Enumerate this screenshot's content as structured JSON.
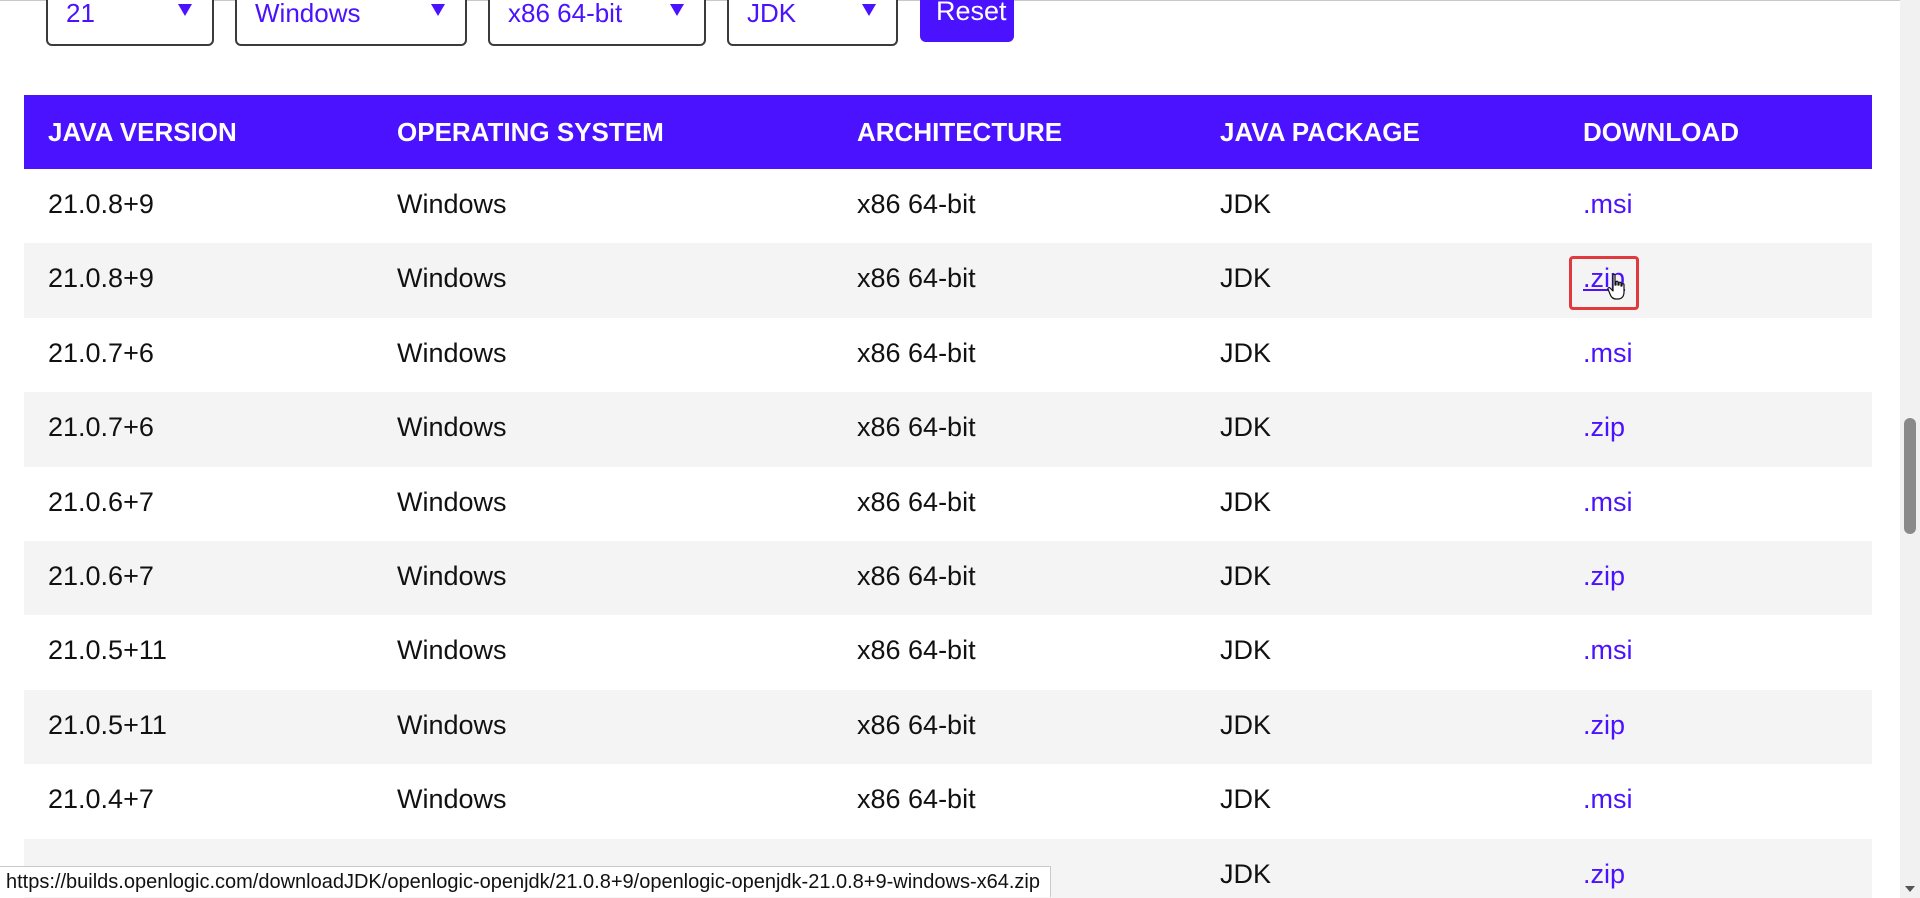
{
  "filters": {
    "version": "21",
    "os": "Windows",
    "arch": "x86 64-bit",
    "package": "JDK",
    "reset_label": "Reset"
  },
  "table": {
    "headers": [
      "JAVA VERSION",
      "OPERATING SYSTEM",
      "ARCHITECTURE",
      "JAVA PACKAGE",
      "DOWNLOAD"
    ],
    "rows": [
      {
        "version": "21.0.8+9",
        "os": "Windows",
        "arch": "x86 64-bit",
        "package": "JDK",
        "download": ".msi"
      },
      {
        "version": "21.0.8+9",
        "os": "Windows",
        "arch": "x86 64-bit",
        "package": "JDK",
        "download": ".zip"
      },
      {
        "version": "21.0.7+6",
        "os": "Windows",
        "arch": "x86 64-bit",
        "package": "JDK",
        "download": ".msi"
      },
      {
        "version": "21.0.7+6",
        "os": "Windows",
        "arch": "x86 64-bit",
        "package": "JDK",
        "download": ".zip"
      },
      {
        "version": "21.0.6+7",
        "os": "Windows",
        "arch": "x86 64-bit",
        "package": "JDK",
        "download": ".msi"
      },
      {
        "version": "21.0.6+7",
        "os": "Windows",
        "arch": "x86 64-bit",
        "package": "JDK",
        "download": ".zip"
      },
      {
        "version": "21.0.5+11",
        "os": "Windows",
        "arch": "x86 64-bit",
        "package": "JDK",
        "download": ".msi"
      },
      {
        "version": "21.0.5+11",
        "os": "Windows",
        "arch": "x86 64-bit",
        "package": "JDK",
        "download": ".zip"
      },
      {
        "version": "21.0.4+7",
        "os": "Windows",
        "arch": "x86 64-bit",
        "package": "JDK",
        "download": ".msi"
      },
      {
        "version": "",
        "os": "",
        "arch": "",
        "package": "JDK",
        "download": ".zip"
      }
    ]
  },
  "status_bar": {
    "url": "https://builds.openlogic.com/downloadJDK/openlogic-openjdk/21.0.8+9/openlogic-openjdk-21.0.8+9-windows-x64.zip"
  },
  "colors": {
    "accent": "#4a12ff",
    "highlight": "#e0393e",
    "row_alt": "#f4f4f4"
  }
}
